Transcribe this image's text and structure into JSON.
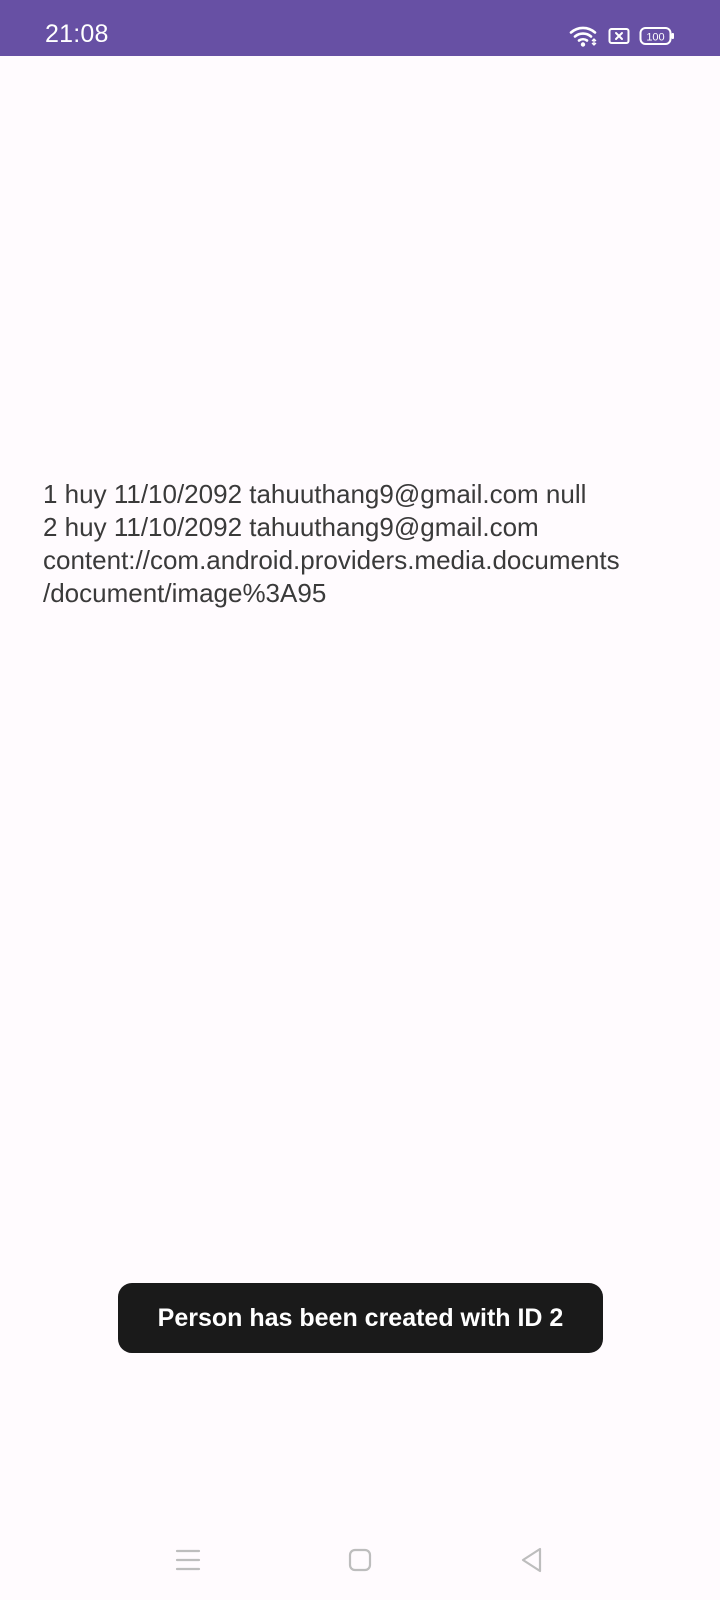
{
  "status_bar": {
    "time": "21:08",
    "icons": [
      "wifi-icon",
      "sim-card-icon",
      "battery-icon"
    ],
    "battery_level": "100",
    "background_color": "#6750a4"
  },
  "content": {
    "lines": [
      "1 huy 11/10/2092 tahuuthang9@gmail.com null",
      "2 huy 11/10/2092 tahuuthang9@gmail.com",
      "content://com.android.providers.media.documents",
      "/document/image%3A95"
    ]
  },
  "toast": {
    "message": "Person has been created with ID 2"
  },
  "nav_bar": {
    "buttons": [
      "menu-icon",
      "home-icon",
      "back-icon"
    ]
  }
}
